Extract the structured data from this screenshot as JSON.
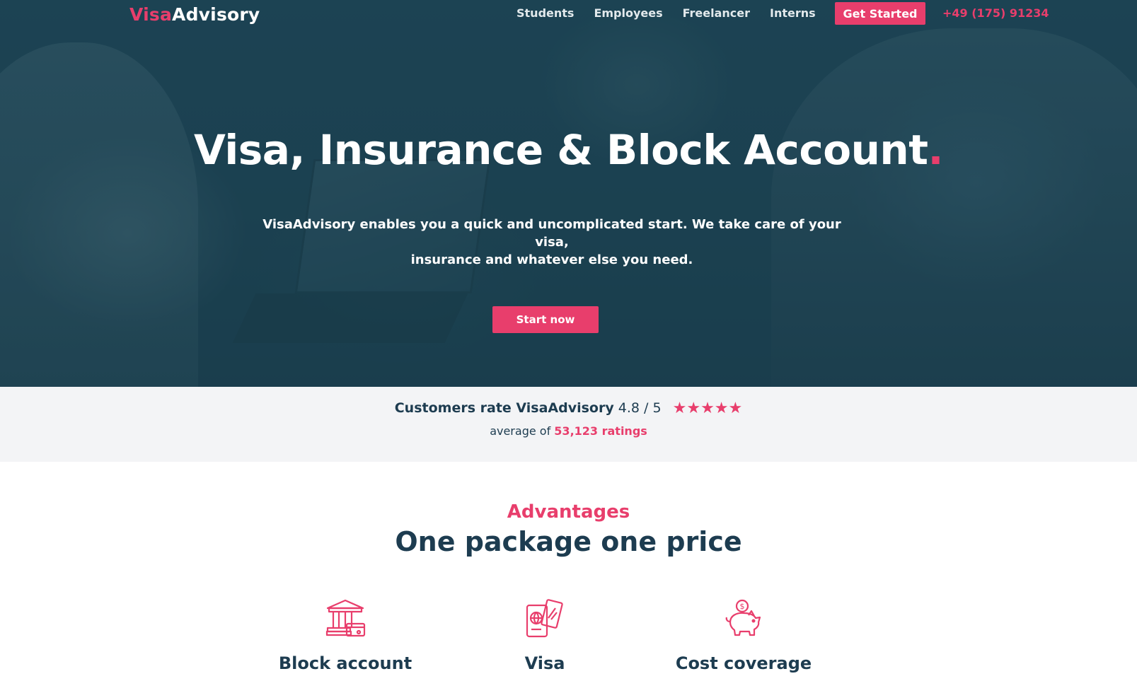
{
  "brand": {
    "part1": "Visa",
    "part2": "Advisory"
  },
  "nav": {
    "links": [
      "Students",
      "Employees",
      "Freelancer",
      "Interns"
    ],
    "cta": "Get Started",
    "phone": "+49 (175) 91234"
  },
  "hero": {
    "title": "Visa, Insurance & Block Account",
    "title_dot": ".",
    "subtitle_line1": "VisaAdvisory enables you a quick and uncomplicated start. We take care of your visa,",
    "subtitle_line2": "insurance and whatever else you need.",
    "button": "Start now"
  },
  "rating": {
    "text": "Customers rate VisaAdvisory",
    "score": "4.8 / 5",
    "stars": "★★★★★",
    "stars_value": 5,
    "avg_prefix": "average of",
    "count": "53,123 ratings"
  },
  "advantages": {
    "kicker": "Advantages",
    "title": "One package one price",
    "items": [
      {
        "icon": "bank-icon",
        "label": "Block account"
      },
      {
        "icon": "passport-icon",
        "label": "Visa"
      },
      {
        "icon": "piggy-bank-icon",
        "label": "Cost coverage"
      }
    ]
  },
  "colors": {
    "accent": "#e83e6c",
    "navy": "#1d3c50",
    "band": "#f3f4f6"
  }
}
